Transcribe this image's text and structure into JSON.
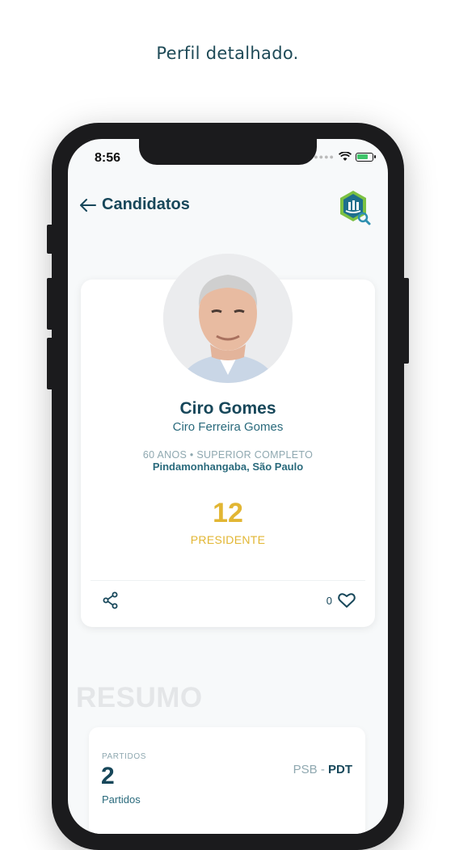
{
  "caption": "Perfil detalhado.",
  "status_bar": {
    "time": "8:56"
  },
  "nav": {
    "title": "Candidatos"
  },
  "candidate": {
    "name": "Ciro Gomes",
    "full_name": "Ciro Ferreira Gomes",
    "details": "60 ANOS • SUPERIOR COMPLETO",
    "location": "Pindamonhangaba, São Paulo",
    "number": "12",
    "office": "PRESIDENTE",
    "likes": "0"
  },
  "summary": {
    "heading": "RESUMO",
    "parties_label": "PARTIDOS",
    "parties_count": "2",
    "parties_sub": "Partidos",
    "party_a": "PSB",
    "party_sep": " - ",
    "party_b": "PDT"
  },
  "colors": {
    "primary": "#17475a",
    "accent": "#e2b633",
    "muted": "#8fa8b0"
  }
}
